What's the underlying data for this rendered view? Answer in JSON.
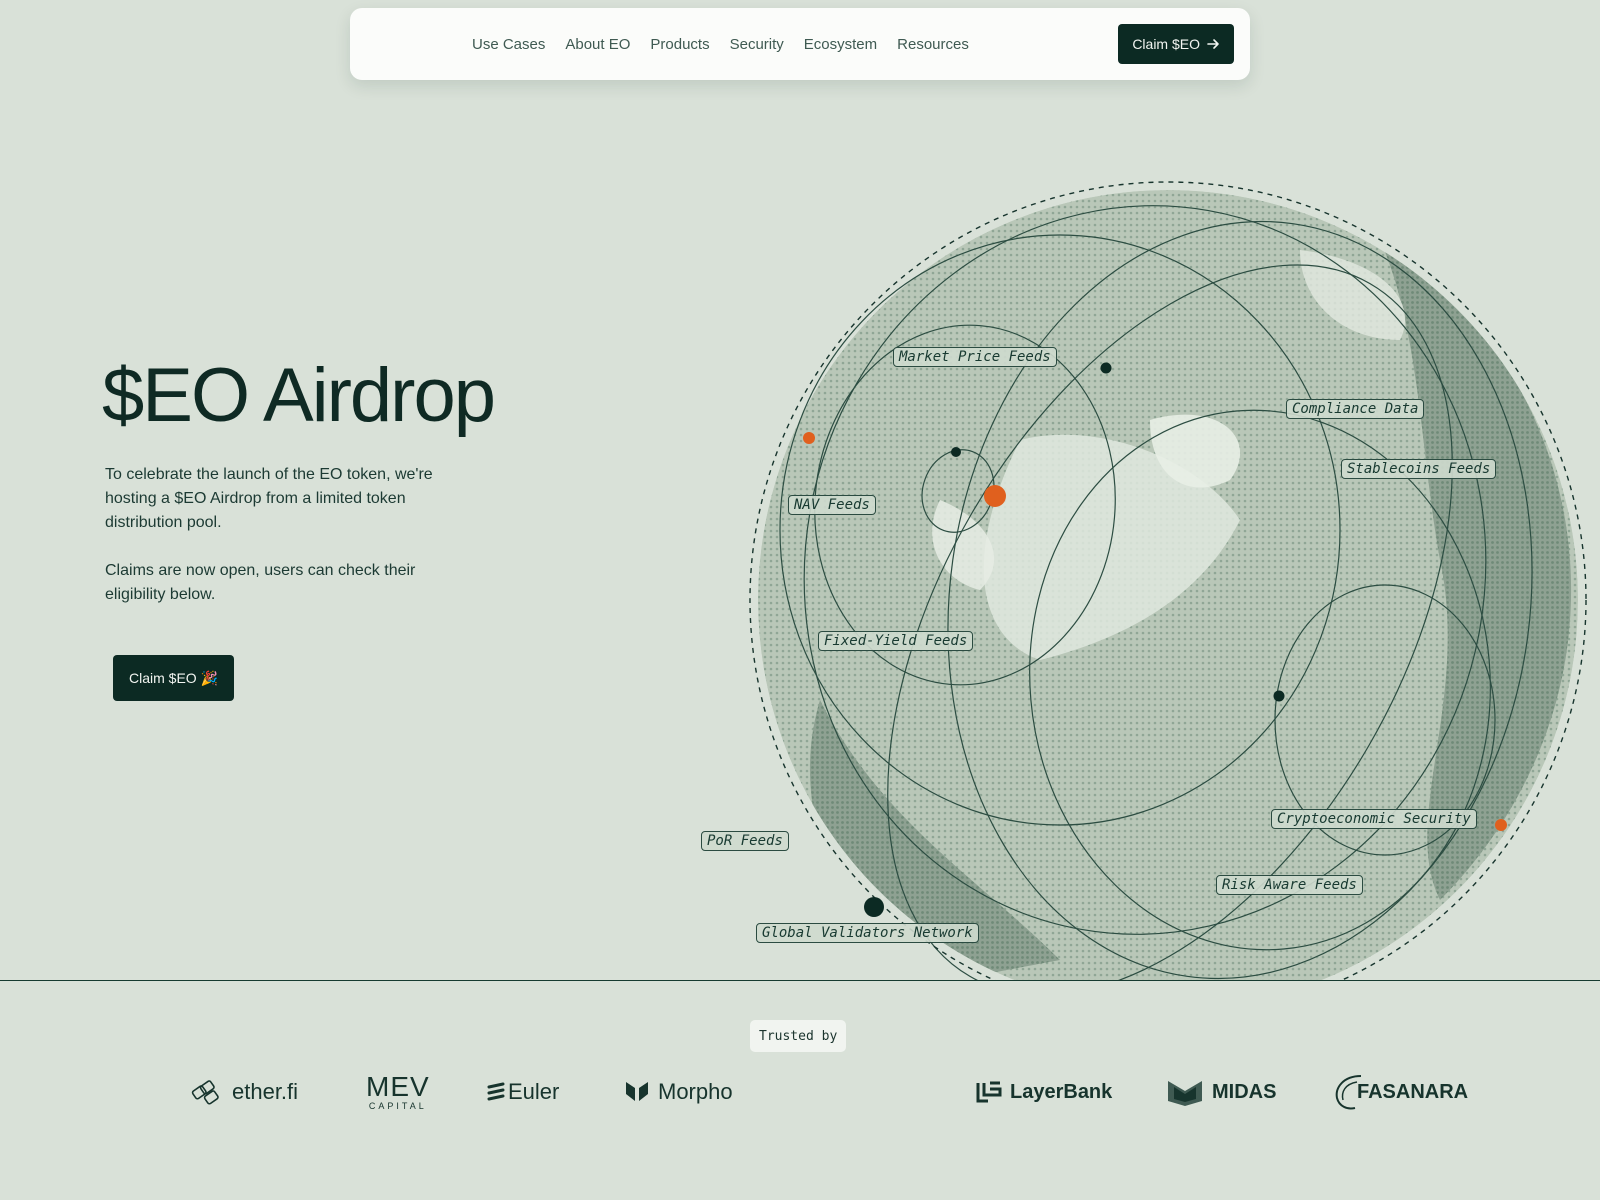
{
  "nav": {
    "links": [
      "Use Cases",
      "About EO",
      "Products",
      "Security",
      "Ecosystem",
      "Resources"
    ],
    "cta_label": "Claim $EO"
  },
  "hero": {
    "title": "$EO Airdrop",
    "paragraph_1": "To celebrate the launch of the EO token, we're hosting a $EO Airdrop from a limited token distribution pool.",
    "paragraph_2": "Claims are now open, users can check their eligibility below.",
    "cta_label": "Claim $EO 🎉"
  },
  "globe": {
    "labels": {
      "market_price": "Market Price Feeds",
      "compliance": "Compliance Data",
      "stablecoins": "Stablecoins Feeds",
      "nav": "NAV Feeds",
      "fixed_yield": "Fixed-Yield Feeds",
      "cryptoeconomic": "Cryptoeconomic Security",
      "risk_aware": "Risk Aware Feeds",
      "por": "PoR Feeds",
      "validators": "Global Validators Network"
    },
    "colors": {
      "accent": "#e0601e",
      "dark": "#0c2a23",
      "land": "#8fa695"
    }
  },
  "trusted": {
    "label": "Trusted by",
    "logos": {
      "etherfi": "ether.fi",
      "mev": "MEV",
      "mev_sub": "CAPITAL",
      "euler": "Euler",
      "morpho": "Morpho",
      "layerbank": "LayerBank",
      "midas": "MIDAS",
      "fasanara": "FASANARA"
    }
  }
}
